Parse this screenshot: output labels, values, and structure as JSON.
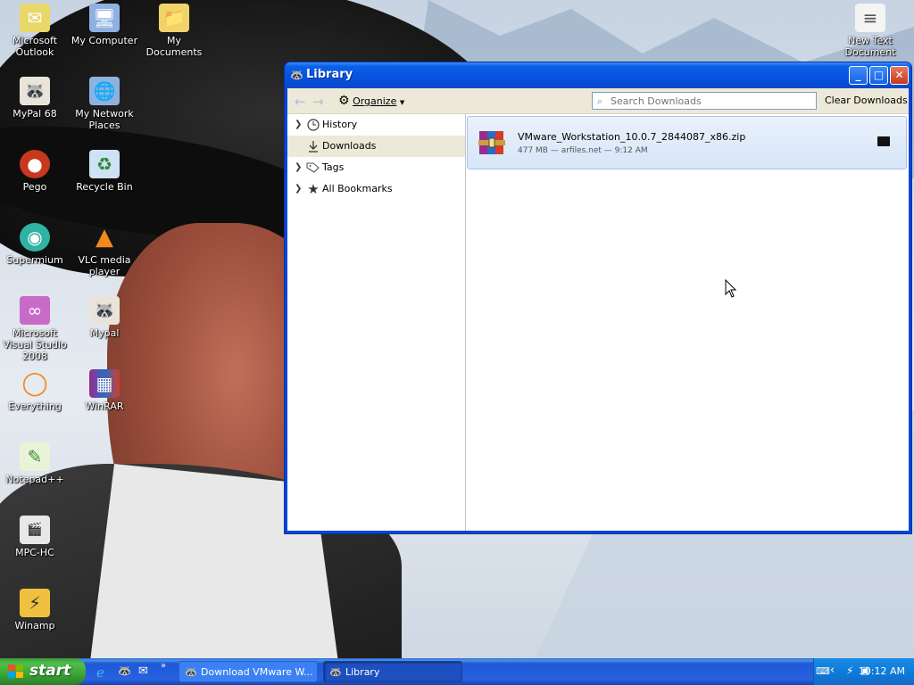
{
  "desktop": {
    "icons": [
      {
        "label": "Microsoft Outlook",
        "icon": "outlook-icon"
      },
      {
        "label": "My Computer",
        "icon": "my-computer-icon"
      },
      {
        "label": "My Documents",
        "icon": "my-documents-icon"
      },
      {
        "label": "New Text Document",
        "icon": "text-document-icon"
      },
      {
        "label": "MyPal 68",
        "icon": "mypal-icon"
      },
      {
        "label": "My Network Places",
        "icon": "network-places-icon"
      },
      {
        "label": "Pego",
        "icon": "pego-icon"
      },
      {
        "label": "Recycle Bin",
        "icon": "recycle-bin-icon"
      },
      {
        "label": "Supermium",
        "icon": "supermium-icon"
      },
      {
        "label": "VLC media player",
        "icon": "vlc-icon"
      },
      {
        "label": "Microsoft Visual Studio 2008",
        "icon": "visual-studio-icon"
      },
      {
        "label": "Mypal",
        "icon": "mypal-icon"
      },
      {
        "label": "Everything",
        "icon": "everything-icon"
      },
      {
        "label": "WinRAR",
        "icon": "winrar-icon"
      },
      {
        "label": "Notepad++",
        "icon": "notepadpp-icon"
      },
      {
        "label": "MPC-HC",
        "icon": "mpc-hc-icon"
      },
      {
        "label": "Winamp",
        "icon": "winamp-icon"
      }
    ]
  },
  "window": {
    "title": "Library",
    "toolbar": {
      "organize_label": "Organize",
      "search_placeholder": "Search Downloads",
      "clear_label": "Clear Downloads"
    },
    "sidebar": [
      {
        "label": "History",
        "icon": "clock-icon",
        "expandable": true,
        "selected": false
      },
      {
        "label": "Downloads",
        "icon": "download-arrow-icon",
        "expandable": false,
        "selected": true
      },
      {
        "label": "Tags",
        "icon": "tag-icon",
        "expandable": true,
        "selected": false
      },
      {
        "label": "All Bookmarks",
        "icon": "star-icon",
        "expandable": true,
        "selected": false
      }
    ],
    "downloads": [
      {
        "name": "VMware_Workstation_10.0.7_2844087_x86.zip",
        "meta": "477 MB — arfiles.net — 9:12 AM",
        "icon": "winrar-archive-icon"
      }
    ]
  },
  "taskbar": {
    "start_label": "start",
    "tasks": [
      {
        "label": "Download VMware W...",
        "icon": "mypal-icon",
        "active": false
      },
      {
        "label": "Library",
        "icon": "mypal-icon",
        "active": true
      }
    ],
    "quicklaunch": [
      "ie-icon",
      "mypal-icon",
      "outlook-express-icon"
    ],
    "clock": "10:12 AM"
  }
}
